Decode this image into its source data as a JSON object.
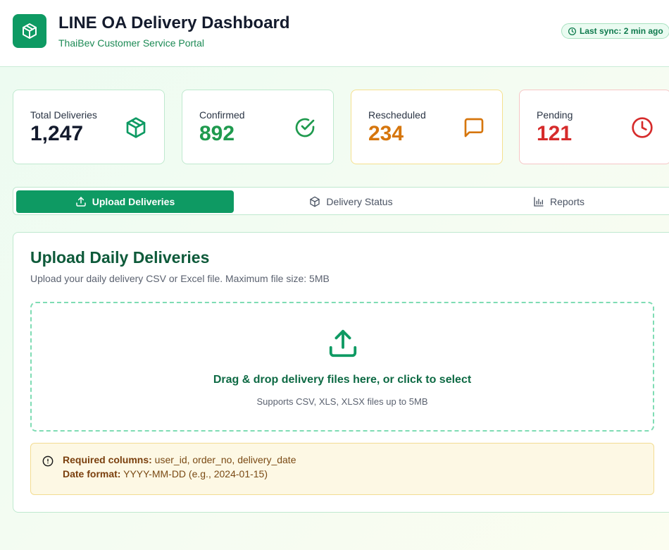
{
  "header": {
    "title": "LINE OA Delivery Dashboard",
    "subtitle": "ThaiBev Customer Service Portal",
    "sync": "Last sync: 2 min ago",
    "logo_icon": "package-icon"
  },
  "stats": [
    {
      "label": "Total Deliveries",
      "value": "1,247",
      "icon": "package-icon",
      "color": "#141b2d"
    },
    {
      "label": "Confirmed",
      "value": "892",
      "icon": "check-circle-icon",
      "color": "#1f9a4e"
    },
    {
      "label": "Rescheduled",
      "value": "234",
      "icon": "message-icon",
      "color": "#d6760d"
    },
    {
      "label": "Pending",
      "value": "121",
      "icon": "clock-icon",
      "color": "#d62b2b"
    }
  ],
  "tabs": [
    {
      "label": "Upload Deliveries",
      "icon": "upload-icon",
      "active": true
    },
    {
      "label": "Delivery Status",
      "icon": "package-icon",
      "active": false
    },
    {
      "label": "Reports",
      "icon": "bar-chart-icon",
      "active": false
    }
  ],
  "upload": {
    "title": "Upload Daily Deliveries",
    "description": "Upload your daily delivery CSV or Excel file. Maximum file size: 5MB",
    "drop_text": "Drag & drop delivery files here, or click to select",
    "drop_hint": "Supports CSV, XLS, XLSX files up to 5MB",
    "required_label": "Required columns:",
    "required_value": " user_id, order_no, delivery_date",
    "format_label": "Date format:",
    "format_value": " YYYY-MM-DD (e.g., 2024-01-15)"
  },
  "colors": {
    "accent": "#0e9a63",
    "warning_bg": "#fdf8e4"
  }
}
